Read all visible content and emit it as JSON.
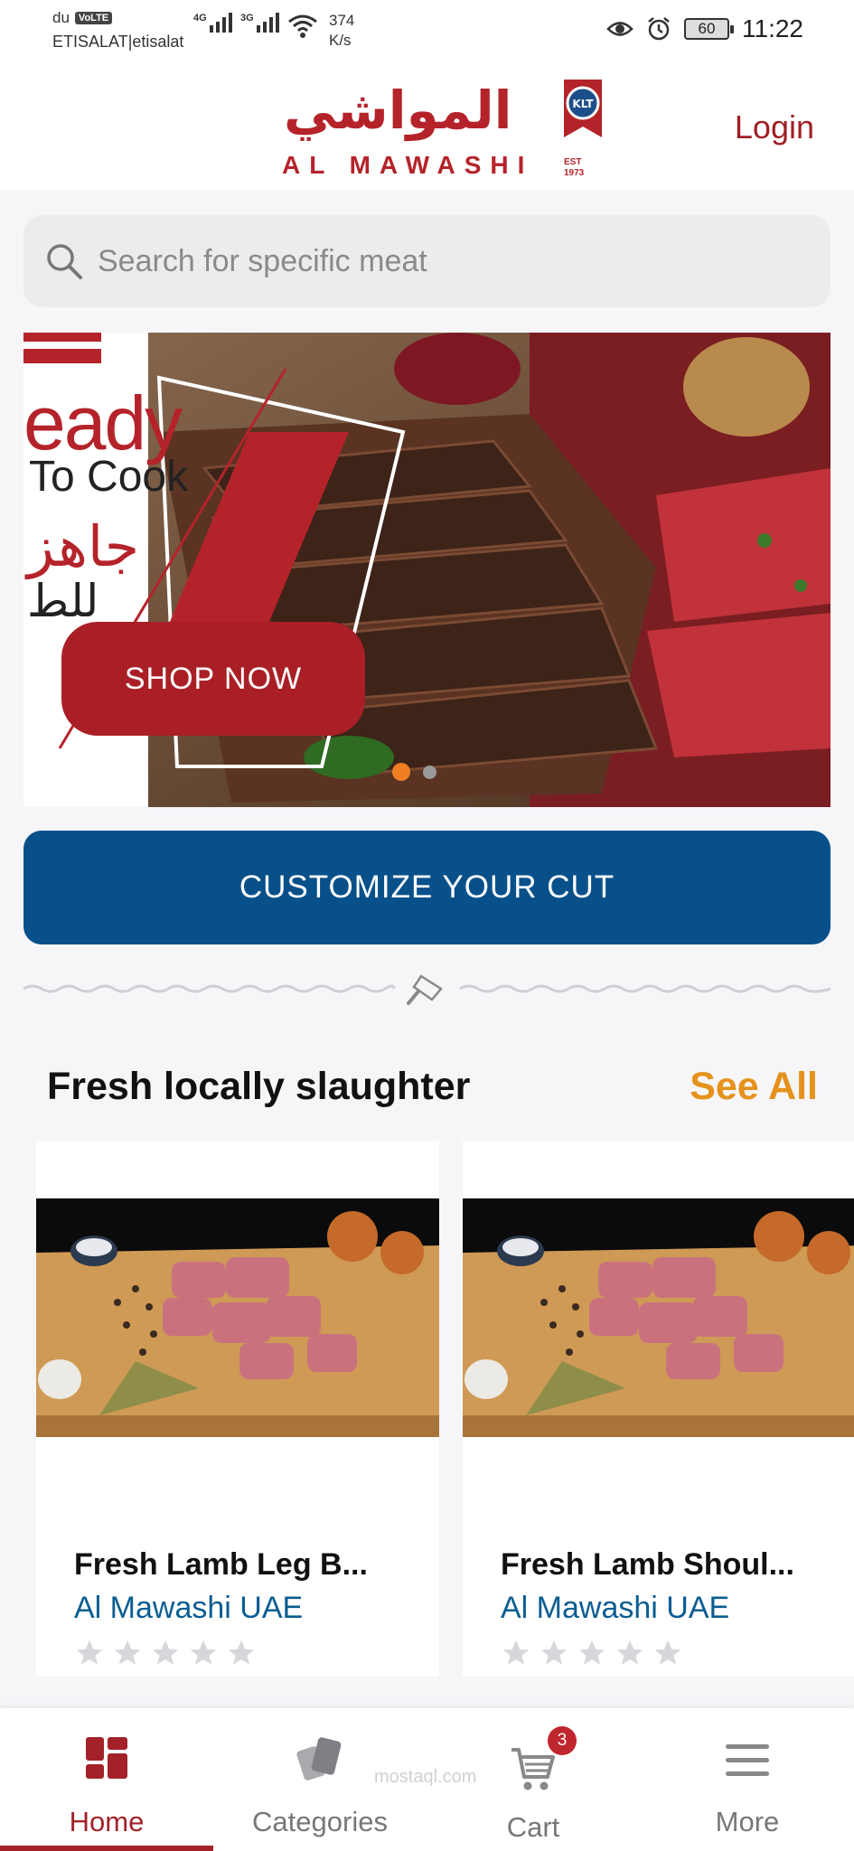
{
  "status_bar": {
    "carrier_primary": "du",
    "volte_label": "VoLTE",
    "carrier_secondary": "ETISALAT|etisalat",
    "network_1": "4G",
    "network_2": "3G",
    "speed_value": "374",
    "speed_unit": "K/s",
    "battery": "60",
    "time": "11:22"
  },
  "header": {
    "logo_arabic": "المواشي",
    "logo_english": "AL MAWASHI",
    "logo_est": "EST",
    "logo_year": "1973",
    "logo_emblem": "KLT",
    "login_label": "Login"
  },
  "search": {
    "placeholder": "Search for specific meat"
  },
  "banner": {
    "headline": "eady",
    "subline": "To Cook",
    "arabic_line1": "جاهز",
    "arabic_line2": "للط",
    "cta_label": "SHOP NOW",
    "slide_count": 2,
    "active_slide": 1
  },
  "customize_label": "CUSTOMIZE YOUR CUT",
  "section": {
    "title": "Fresh locally slaughter",
    "see_all_label": "See All"
  },
  "products": [
    {
      "name": "Fresh Lamb Leg B...",
      "brand": "Al Mawashi UAE",
      "rating": 0
    },
    {
      "name": "Fresh Lamb Shoul...",
      "brand": "Al Mawashi UAE",
      "rating": 0
    }
  ],
  "bottom_nav": {
    "items": [
      {
        "label": "Home",
        "icon": "home-grid-icon",
        "active": true
      },
      {
        "label": "Categories",
        "icon": "categories-icon",
        "active": false
      },
      {
        "label": "Cart",
        "icon": "cart-icon",
        "active": false,
        "badge": "3"
      },
      {
        "label": "More",
        "icon": "menu-icon",
        "active": false
      }
    ]
  },
  "watermark": "mostaql.com",
  "colors": {
    "brand_red": "#a3222a",
    "brand_blue": "#08508a",
    "accent_orange": "#e5921c",
    "brand_text_blue": "#0a5d92"
  }
}
